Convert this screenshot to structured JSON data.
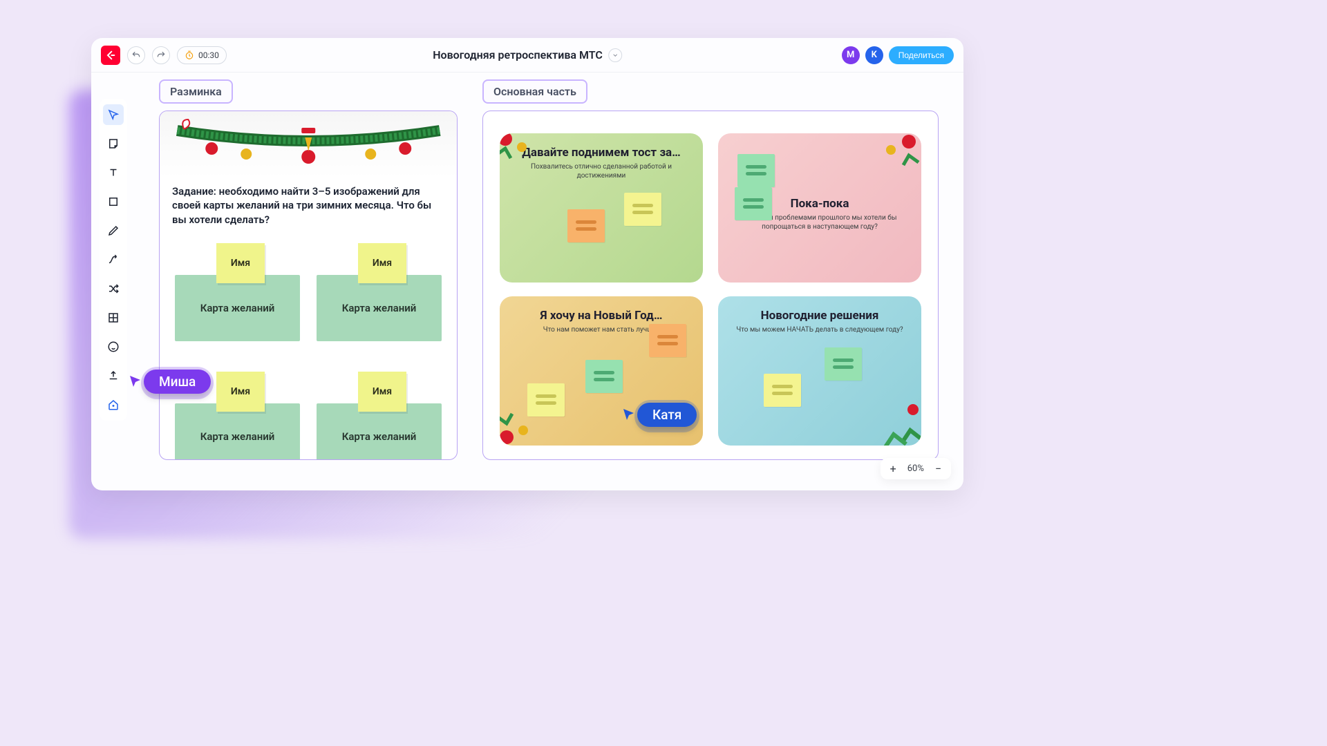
{
  "header": {
    "timer": "00:30",
    "title": "Новогодняя ретроспектива МТС",
    "avatars": [
      "M",
      "K"
    ],
    "share_label": "Поделиться"
  },
  "zoom": {
    "level": "60%"
  },
  "frames": {
    "warmup": {
      "label": "Разминка",
      "task": "Задание: необходимо найти 3–5 изображений для своей карты желаний на три зимних месяца.  Что бы вы хотели сделать?",
      "name_label": "Имя",
      "card_label": "Карта желаний"
    },
    "main": {
      "label": "Основная часть",
      "quads": [
        {
          "title": "Давайте поднимем тост за…",
          "sub": "Похвалитесь отлично сделанной работой и достижениями"
        },
        {
          "title": "Пока-пока",
          "sub": "С какими проблемами прошлого мы хотели бы попрощаться в наступающем году?"
        },
        {
          "title": "Я хочу на Новый Год…",
          "sub": "Что нам поможет нам стать лучше?"
        },
        {
          "title": "Новогодние решения",
          "sub": "Что мы можем НАЧАТЬ делать в следующем году?"
        }
      ]
    }
  },
  "cursors": [
    {
      "name": "Миша",
      "color": "#7c3aed"
    },
    {
      "name": "Катя",
      "color": "#2157d6"
    }
  ]
}
